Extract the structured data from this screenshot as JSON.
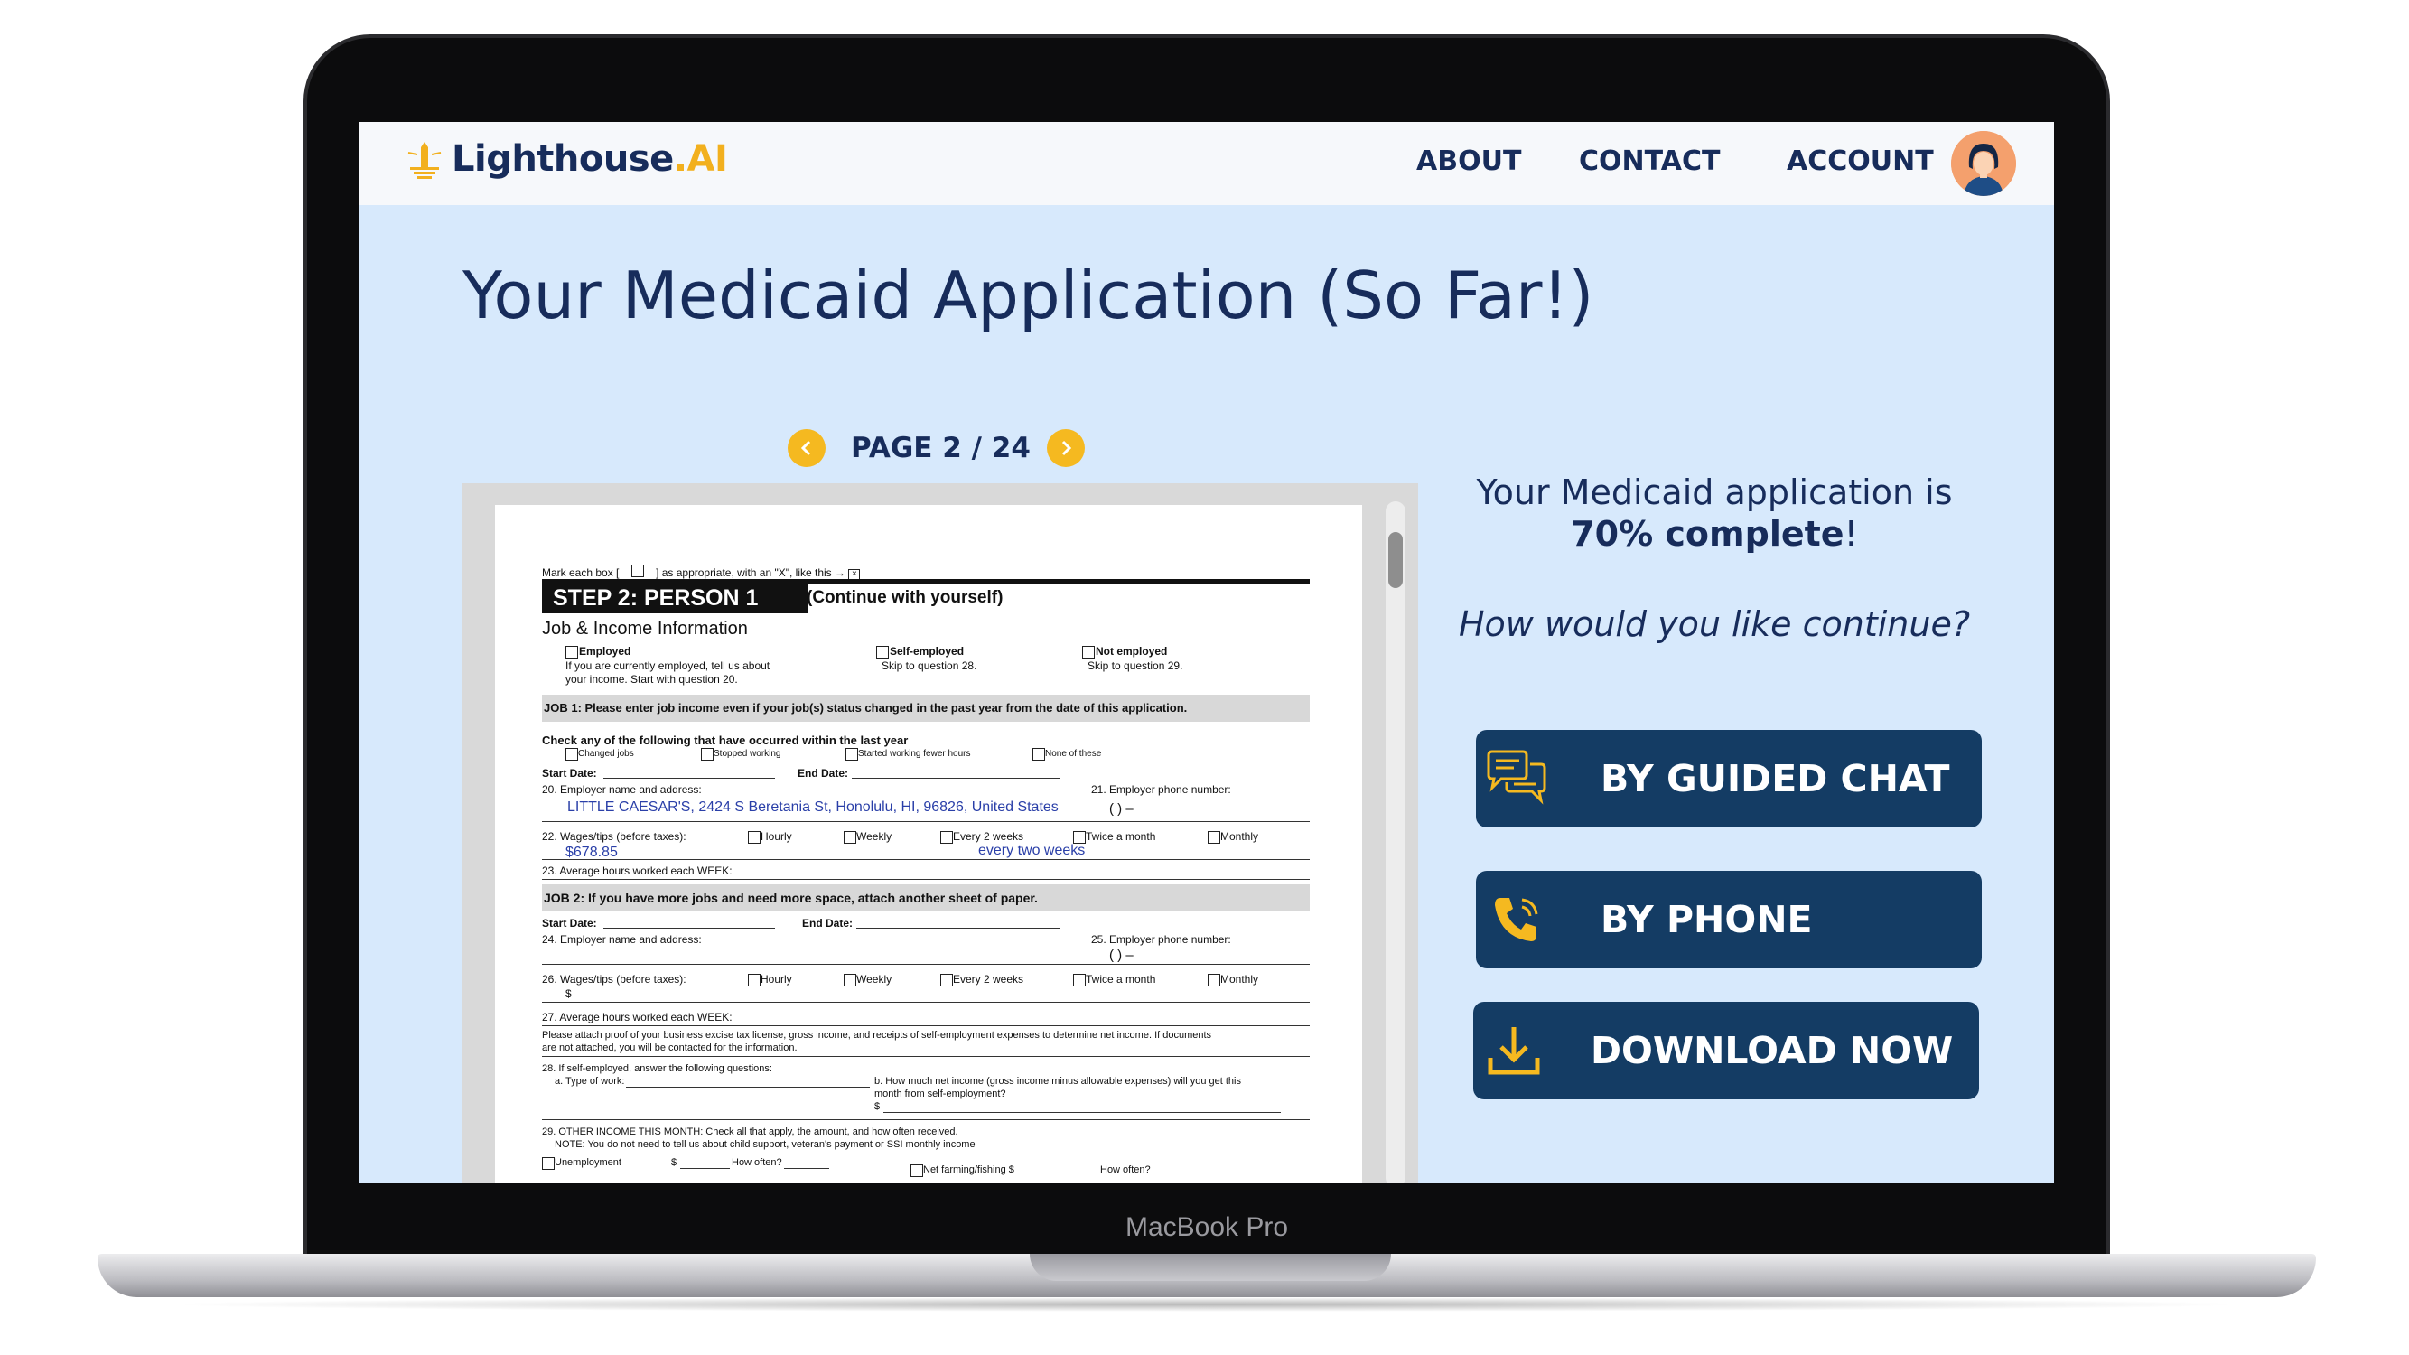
{
  "device": {
    "label": "MacBook Pro"
  },
  "brand": {
    "name": "Lighthouse",
    "suffix": ".AI",
    "accent": "#f2b01e",
    "primary": "#172c5b"
  },
  "nav": {
    "about": "ABOUT",
    "contact": "CONTACT",
    "account": "ACCOUNT"
  },
  "page": {
    "title": "Your Medicaid Application (So Far!)"
  },
  "pager": {
    "label": "PAGE 2 / 24"
  },
  "progress": {
    "line1": "Your Medicaid application is",
    "percent_text": "70% complete",
    "suffix": "!",
    "value": 0.7,
    "question": "How would you like continue?"
  },
  "actions": {
    "chat": "BY GUIDED CHAT",
    "phone": "BY PHONE",
    "download": "DOWNLOAD NOW"
  },
  "form": {
    "mark_instruction_a": "Mark each box [",
    "mark_instruction_b": "] as appropriate, with an \"X\", like this →",
    "step_label": "STEP 2: PERSON 1",
    "step_sub": "(Continue with yourself)",
    "section": "Job & Income Information",
    "employed": "Employed",
    "employed_note1": "If you are currently employed, tell us about",
    "employed_note2": "your income.  Start with  question 20.",
    "self_employed": "Self-employed",
    "self_employed_note": "Skip to question 28.",
    "not_employed": "Not employed",
    "not_employed_note": "Skip to question 29.",
    "job1": "JOB 1: Please enter job income even if your job(s) status changed in the past year from the date of this application.",
    "check_any": "Check any of the following that have occurred within the last year",
    "changed_jobs": "Changed jobs",
    "stopped_working": "Stopped working",
    "started_fewer": "Started working fewer hours",
    "none_of_these": "None of these",
    "start_date": "Start Date:",
    "end_date": "End Date:",
    "q20": "20.  Employer name and address:",
    "q21": "21.  Employer phone number:",
    "employer_value": "LITTLE CAESAR'S, 2424 S Beretania St, Honolulu, HI, 96826, United States",
    "phone_paren": "(          )          –",
    "q22": "22.  Wages/tips (before taxes):",
    "hourly": "Hourly",
    "weekly": "Weekly",
    "every2": "Every 2 weeks",
    "twice": "Twice a month",
    "monthly": "Monthly",
    "wage_value": "$678.85",
    "freq_value": "every two weeks",
    "q23": "23.    Average hours worked each WEEK:",
    "job2": "JOB 2:  If you have more jobs and need more space, attach another sheet of paper.",
    "q24": "24.  Employer name and address:",
    "q25": "25.  Employer phone number:",
    "q26": "26.  Wages/tips (before taxes):",
    "dollar": "$",
    "q27": "27.  Average hours worked each WEEK:",
    "attach1": "Please attach proof of your business excise tax license, gross income, and receipts of self-employment expenses to determine net income.  If documents",
    "attach2": "are not attached, you will be contacted for the information.",
    "q28": "28.  If self-employed, answer the following questions:",
    "q28a": "a. Type of work:",
    "q28b1": "b. How much net income (gross income minus allowable expenses) will you get this",
    "q28b2": "month from self-employment?",
    "q29": "29. OTHER INCOME THIS MONTH: Check all that apply, the amount, and how often received.",
    "q29note": "NOTE:  You do not need to tell us about child support, veteran's payment or SSI monthly income",
    "unemployment": "Unemployment",
    "how_often": "How often?",
    "net_farming": "Net farming/fishing  $"
  }
}
